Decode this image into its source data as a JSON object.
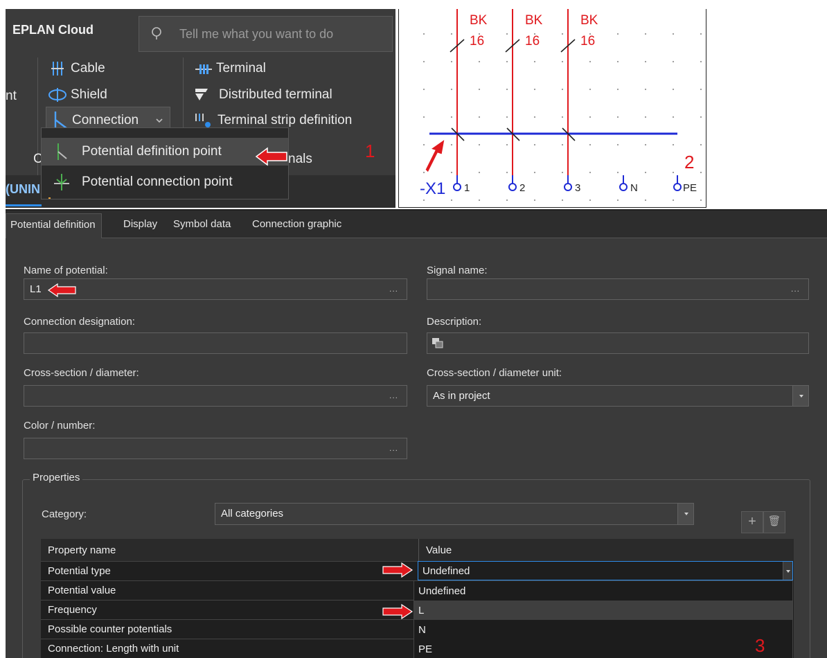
{
  "ribbon": {
    "app_title": "EPLAN Cloud",
    "search_placeholder": "Tell me what you want to do",
    "cut_label_nt": "nt",
    "cut_label_c": "C",
    "cut_label_nals": "nals",
    "items": {
      "cable": "Cable",
      "shield": "Shield",
      "connection": "Connection",
      "terminal": "Terminal",
      "distributed_terminal": "Distributed terminal",
      "terminal_strip_definition": "Terminal strip definition"
    },
    "tab_fragment": "(UNIN",
    "callout_1": "1"
  },
  "menu": {
    "items": [
      {
        "label": "Potential definition point",
        "selected": true
      },
      {
        "label": "Potential connection point",
        "selected": false
      }
    ]
  },
  "schematic": {
    "wire_labels": [
      {
        "color": "BK",
        "size": "16"
      },
      {
        "color": "BK",
        "size": "16"
      },
      {
        "color": "BK",
        "size": "16"
      }
    ],
    "strip_label": "-X1",
    "terminals": [
      "1",
      "2",
      "3",
      "N",
      "PE"
    ],
    "callout_2": "2",
    "colors": {
      "wire": "#e0191e",
      "bus": "#1f2bd6"
    }
  },
  "dialog": {
    "tabs": [
      "Potential definition",
      "Display",
      "Symbol data",
      "Connection graphic"
    ],
    "active_tab": "Potential definition",
    "fields": {
      "name_of_potential": {
        "label": "Name of potential:",
        "value": "L1"
      },
      "signal_name": {
        "label": "Signal name:",
        "value": ""
      },
      "connection_designation": {
        "label": "Connection designation:",
        "value": ""
      },
      "description": {
        "label": "Description:",
        "value": ""
      },
      "cross_section": {
        "label": "Cross-section / diameter:",
        "value": ""
      },
      "cross_section_unit": {
        "label": "Cross-section / diameter unit:",
        "value": "As in project"
      },
      "color_number": {
        "label": "Color / number:",
        "value": ""
      }
    },
    "properties": {
      "legend": "Properties",
      "category_label": "Category:",
      "category_value": "All categories",
      "grid_headers": [
        "Property name",
        "Value"
      ],
      "rows": [
        "Potential type",
        "Potential value",
        "Frequency",
        "Possible counter potentials",
        "Connection: Length with unit"
      ],
      "value_selected": "Undefined",
      "options": [
        "Undefined",
        "L",
        "N",
        "PE"
      ],
      "highlighted_option": "L"
    },
    "callout_3": "3"
  }
}
